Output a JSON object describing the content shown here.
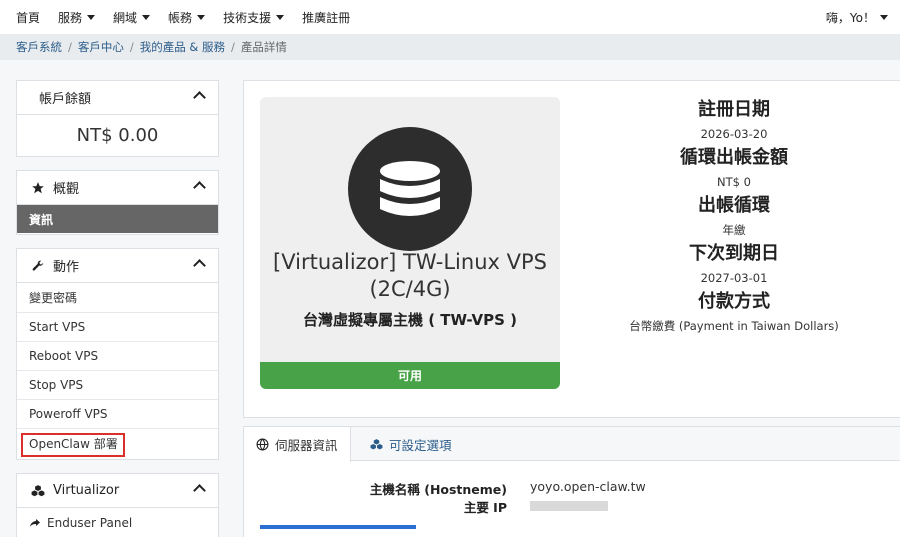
{
  "nav": {
    "home": "首頁",
    "services": "服務",
    "domains": "網域",
    "billing": "帳務",
    "support": "技術支援",
    "affiliates": "推廣註冊",
    "user": "嗨，Yo！"
  },
  "breadcrumb": {
    "items": [
      "客戶系統",
      "客戶中心",
      "我的產品 & 服務"
    ],
    "current": "產品詳情"
  },
  "sidebar": {
    "balance_title": "帳戶餘額",
    "balance_value": "NT$ 0.00",
    "overview_title": "概觀",
    "overview_active": "資訊",
    "actions_title": "動作",
    "actions": [
      "變更密碼",
      "Start VPS",
      "Reboot VPS",
      "Stop VPS",
      "Poweroff VPS",
      "OpenClaw 部署"
    ],
    "virtualizor_title": "Virtualizor",
    "virtualizor_items": [
      "Enduser Panel"
    ]
  },
  "product": {
    "name": "[Virtualizor] TW-Linux VPS (2C/4G)",
    "group": "台灣虛擬專屬主機 ( TW-VPS )",
    "status": "可用"
  },
  "details": {
    "reg_label": "註冊日期",
    "reg_value": "2026-03-20",
    "recurring_label": "循環出帳金額",
    "recurring_value": "NT$ 0",
    "cycle_label": "出帳循環",
    "cycle_value": "年繳",
    "due_label": "下次到期日",
    "due_value": "2027-03-01",
    "payment_label": "付款方式",
    "payment_value": "台幣繳費 (Payment in Taiwan Dollars)"
  },
  "tabs": {
    "server_info": "伺服器資訊",
    "config": "可設定選項"
  },
  "server": {
    "hostname_label": "主機名稱 (Hostneme)",
    "hostname_value": "yoyo.open-claw.tw",
    "ip_label": "主要 IP"
  },
  "colors": {
    "status_green": "#48a348",
    "highlight_red": "#d9302c",
    "active_gray": "#666666"
  }
}
